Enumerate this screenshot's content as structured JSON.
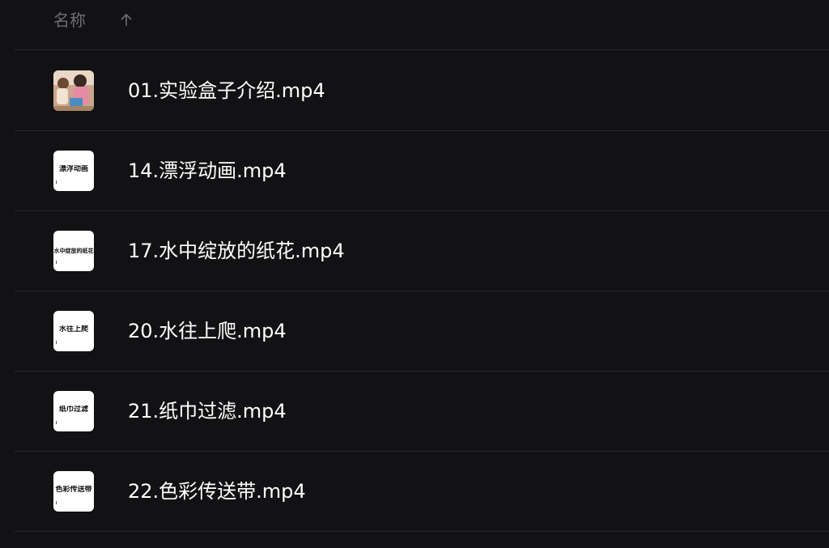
{
  "header": {
    "column_label": "名称",
    "sort_icon": "arrow-up-icon"
  },
  "files": [
    {
      "name": "01.实验盒子介绍.mp4",
      "thumbnail_type": "photo",
      "thumbnail_text": ""
    },
    {
      "name": "14.漂浮动画.mp4",
      "thumbnail_type": "text",
      "thumbnail_text": "漂浮动画"
    },
    {
      "name": "17.水中绽放的纸花.mp4",
      "thumbnail_type": "text",
      "thumbnail_text": "水中绽放的纸花"
    },
    {
      "name": "20.水往上爬.mp4",
      "thumbnail_type": "text",
      "thumbnail_text": "水往上爬"
    },
    {
      "name": "21.纸巾过滤.mp4",
      "thumbnail_type": "text",
      "thumbnail_text": "纸巾过滤"
    },
    {
      "name": "22.色彩传送带.mp4",
      "thumbnail_type": "text",
      "thumbnail_text": "色彩传送带"
    }
  ]
}
